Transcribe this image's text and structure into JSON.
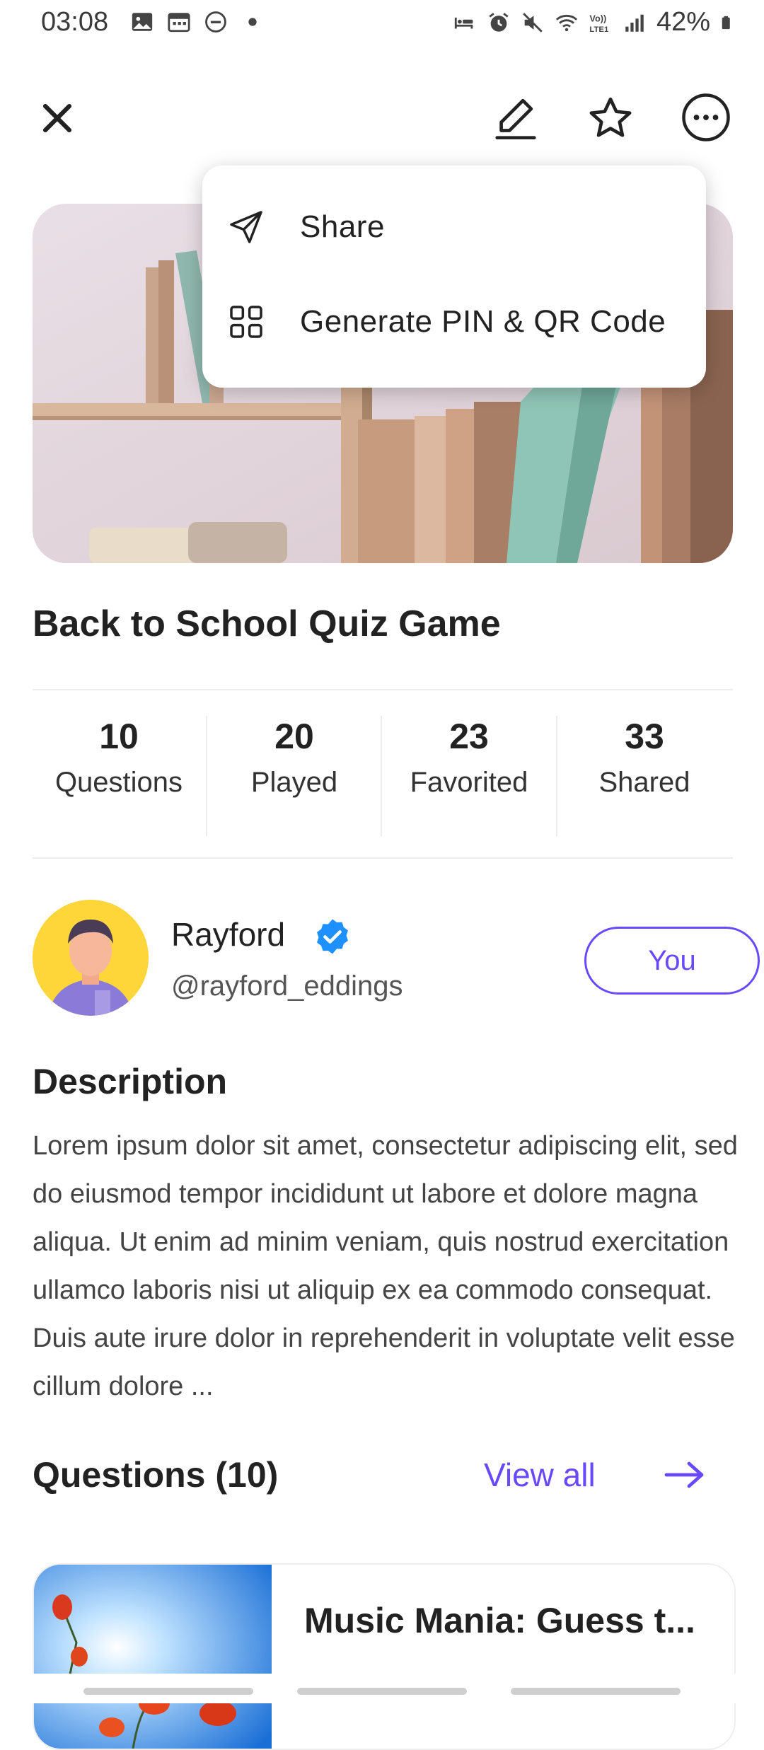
{
  "status_bar": {
    "time": "03:08",
    "battery": "42%",
    "left_icons": [
      "image-icon",
      "calendar-icon",
      "dnd-icon",
      "dot-icon"
    ],
    "right_icons": [
      "bed-icon",
      "alarm-icon",
      "mute-icon",
      "wifi-icon",
      "volte-icon",
      "signal-icon",
      "battery-icon"
    ]
  },
  "toolbar": {
    "icons": [
      "close-icon",
      "edit-icon",
      "star-icon",
      "more-icon"
    ]
  },
  "menu": {
    "items": [
      {
        "label": "Share",
        "icon": "send-icon"
      },
      {
        "label": "Generate PIN & QR Code",
        "icon": "grid-icon"
      }
    ]
  },
  "quiz": {
    "title": "Back to School Quiz Game",
    "stats": [
      {
        "value": "10",
        "label": "Questions"
      },
      {
        "value": "20",
        "label": "Played"
      },
      {
        "value": "23",
        "label": "Favorited"
      },
      {
        "value": "33",
        "label": "Shared"
      }
    ]
  },
  "author": {
    "name": "Rayford",
    "handle": "@rayford_eddings",
    "button": "You"
  },
  "description": {
    "heading": "Description",
    "text": "Lorem ipsum dolor sit amet, consectetur adipiscing elit, sed do eiusmod tempor incididunt ut labore et dolore magna aliqua. Ut enim ad minim veniam, quis nostrud exercitation ullamco laboris nisi ut aliquip ex ea commodo consequat. Duis aute irure dolor in reprehenderit in voluptate velit esse cillum dolore ..."
  },
  "questions": {
    "heading": "Questions (10)",
    "view_all": "View all",
    "cards": [
      {
        "title": "Music Mania: Guess t..."
      }
    ]
  },
  "colors": {
    "accent": "#6949ff",
    "verified": "#1e90ff"
  }
}
